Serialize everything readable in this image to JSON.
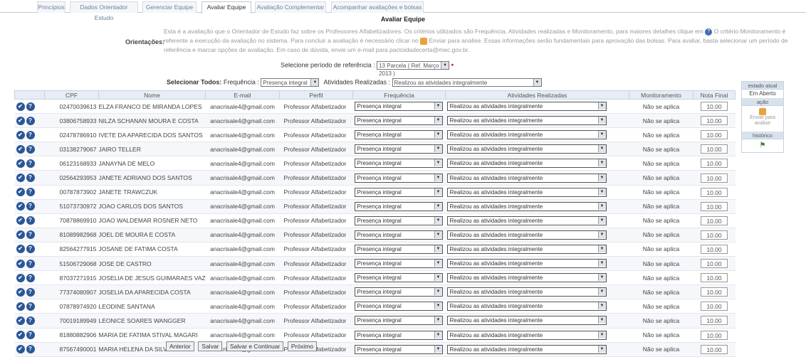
{
  "tabs": [
    {
      "label": "Princípios",
      "active": false
    },
    {
      "label": "Dados Orientador Estudo",
      "active": false
    },
    {
      "label": "Gerenciar Equipe",
      "active": false
    },
    {
      "label": "Avaliar Equipe",
      "active": true
    },
    {
      "label": "Avaliação Complementar",
      "active": false
    },
    {
      "label": "Acompanhar avaliações e bolsas",
      "active": false
    }
  ],
  "page_title": "Avaliar Equipe",
  "orientacoes": {
    "label": "Orientações:",
    "text_1": "Esta é a avaliação que o Orientador de Estudo faz sobre os Professores Alfabetizadores. Os critérios utilizados são Frequência, Atividades realizadas e Monitoramento, para maiores detalhes clique em",
    "text_2": "O critério Monitoramento é referente a execução da avaliação no sistema. Para concluir a avaliação é necessário clicar no",
    "text_3": "Enviar para análise. Essas informações serão fundamentais para aprovação das bolsas. Para avaliar, basta selecionar um período de referência e marcar opções de avaliação. Em caso de dúvida, envie um e-mail para pactoidadecerta@mec.gov.br."
  },
  "periodo": {
    "label": "Selecione período de referência :",
    "value": "13 Parcela ( Ref. Março / 2013 )"
  },
  "selecionar_todos": {
    "label": "Selecionar Todos:",
    "frequencia_label": "Frequência :",
    "frequencia_value": "Presença integral",
    "atividades_label": "Atividades Realizadas :",
    "atividades_value": "Realizou as atividades integralmente"
  },
  "table": {
    "headers": [
      "",
      "CPF",
      "Nome",
      "E-mail",
      "Perfil",
      "Frequência",
      "Atividades Realizadas",
      "Monitoramento",
      "Nota Final"
    ],
    "rows": [
      {
        "cpf": "02470039613",
        "nome": "ELZA FRANCO DE MIRANDA LOPES",
        "email": "anacrisale4@gmail.com",
        "perfil": "Professor Alfabetizador",
        "freq": "Presença integral",
        "ativ": "Realizou as atividades integralmente",
        "monit": "Não se aplica",
        "nota": "10.00"
      },
      {
        "cpf": "03806758933",
        "nome": "NILZA SCHANAN MOURA E COSTA",
        "email": "anacrisale4@gmail.com",
        "perfil": "Professor Alfabetizador",
        "freq": "Presença integral",
        "ativ": "Realizou as atividades integralmente",
        "monit": "Não se aplica",
        "nota": "10.00"
      },
      {
        "cpf": "02478786910",
        "nome": "IVETE DA APARECIDA DOS SANTOS",
        "email": "anacrisale4@gmail.com",
        "perfil": "Professor Alfabetizador",
        "freq": "Presença integral",
        "ativ": "Realizou as atividades integralmente",
        "monit": "Não se aplica",
        "nota": "10.00"
      },
      {
        "cpf": "03138279067",
        "nome": "JAIRO TELLER",
        "email": "anacrisale4@gmail.com",
        "perfil": "Professor Alfabetizador",
        "freq": "Presença integral",
        "ativ": "Realizou as atividades integralmente",
        "monit": "Não se aplica",
        "nota": "10.00"
      },
      {
        "cpf": "06123168933",
        "nome": "JANAYNA DE MELO",
        "email": "anacrisale4@gmail.com",
        "perfil": "Professor Alfabetizador",
        "freq": "Presença integral",
        "ativ": "Realizou as atividades integralmente",
        "monit": "Não se aplica",
        "nota": "10.00"
      },
      {
        "cpf": "02564293953",
        "nome": "JANETE ADRIANO DOS SANTOS",
        "email": "anacrisale4@gmail.com",
        "perfil": "Professor Alfabetizador",
        "freq": "Presença integral",
        "ativ": "Realizou as atividades integralmente",
        "monit": "Não se aplica",
        "nota": "10.00"
      },
      {
        "cpf": "00787873902",
        "nome": "JANETE TRAWCZUK",
        "email": "anacrisale4@gmail.com",
        "perfil": "Professor Alfabetizador",
        "freq": "Presença integral",
        "ativ": "Realizou as atividades integralmente",
        "monit": "Não se aplica",
        "nota": "10.00"
      },
      {
        "cpf": "51073730972",
        "nome": "JOAO CARLOS DOS SANTOS",
        "email": "anacrisale4@gmail.com",
        "perfil": "Professor Alfabetizador",
        "freq": "Presença integral",
        "ativ": "Realizou as atividades integralmente",
        "monit": "Não se aplica",
        "nota": "10.00"
      },
      {
        "cpf": "70878869910",
        "nome": "JOAO WALDEMAR ROSNER NETO",
        "email": "anacrisale4@gmail.com",
        "perfil": "Professor Alfabetizador",
        "freq": "Presença integral",
        "ativ": "Realizou as atividades integralmente",
        "monit": "Não se aplica",
        "nota": "10.00"
      },
      {
        "cpf": "81089982968",
        "nome": "JOEL DE MOURA E COSTA",
        "email": "anacrisale4@gmail.com",
        "perfil": "Professor Alfabetizador",
        "freq": "Presença integral",
        "ativ": "Realizou as atividades integralmente",
        "monit": "Não se aplica",
        "nota": "10.00"
      },
      {
        "cpf": "82564277915",
        "nome": "JOSANE DE FATIMA COSTA",
        "email": "anacrisale4@gmail.com",
        "perfil": "Professor Alfabetizador",
        "freq": "Presença integral",
        "ativ": "Realizou as atividades integralmente",
        "monit": "Não se aplica",
        "nota": "10.00"
      },
      {
        "cpf": "51506729068",
        "nome": "JOSE DE CASTRO",
        "email": "anacrisale4@gmail.com",
        "perfil": "Professor Alfabetizador",
        "freq": "Presença integral",
        "ativ": "Realizou as atividades integralmente",
        "monit": "Não se aplica",
        "nota": "10.00"
      },
      {
        "cpf": "87037271915",
        "nome": "JOSELIA DE JESUS GUIMARAES VAZ",
        "email": "anacrisale4@gmail.com",
        "perfil": "Professor Alfabetizador",
        "freq": "Presença integral",
        "ativ": "Realizou as atividades integralmente",
        "monit": "Não se aplica",
        "nota": "10.00"
      },
      {
        "cpf": "77374080907",
        "nome": "JOSELIA DA APARECIDA COSTA",
        "email": "anacrisale4@gmail.com",
        "perfil": "Professor Alfabetizador",
        "freq": "Presença integral",
        "ativ": "Realizou as atividades integralmente",
        "monit": "Não se aplica",
        "nota": "10.00"
      },
      {
        "cpf": "07878974920",
        "nome": "LEODINE SANTANA",
        "email": "anacrisale4@gmail.com",
        "perfil": "Professor Alfabetizador",
        "freq": "Presença integral",
        "ativ": "Realizou as atividades integralmente",
        "monit": "Não se aplica",
        "nota": "10.00"
      },
      {
        "cpf": "70019189949",
        "nome": "LEONICE SOARES WANGGER",
        "email": "anacrisale4@gmail.com",
        "perfil": "Professor Alfabetizador",
        "freq": "Presença integral",
        "ativ": "Realizou as atividades integralmente",
        "monit": "Não se aplica",
        "nota": "10.00"
      },
      {
        "cpf": "81880882906",
        "nome": "MARIA DE FATIMA STIVAL MAGARI",
        "email": "anacrisale4@gmail.com",
        "perfil": "Professor Alfabetizador",
        "freq": "Presença integral",
        "ativ": "Realizou as atividades integralmente",
        "monit": "Não se aplica",
        "nota": "10.00"
      },
      {
        "cpf": "87567490001",
        "nome": "MARIA HELENA DA SILVA",
        "email": "anacrisale4@gmail.com",
        "perfil": "Professor Alfabetizador",
        "freq": "Presença integral",
        "ativ": "Realizou as atividades integralmente",
        "monit": "Não se aplica",
        "nota": "10.00"
      }
    ]
  },
  "side_panel": {
    "estado_label": "estado atual",
    "estado_value": "Em Aberto",
    "acao_label": "ação",
    "enviar_label": "Enviar para análise",
    "historico_label": "histórico"
  },
  "actions": {
    "anterior": "Anterior",
    "salvar": "Salvar",
    "salvar_continuar": "Salvar e Continuar",
    "proximo": "Próximo"
  },
  "colors": {
    "accent": "#2b5797",
    "warning_red": "#d20000",
    "header_bg": "#e6edf5"
  }
}
